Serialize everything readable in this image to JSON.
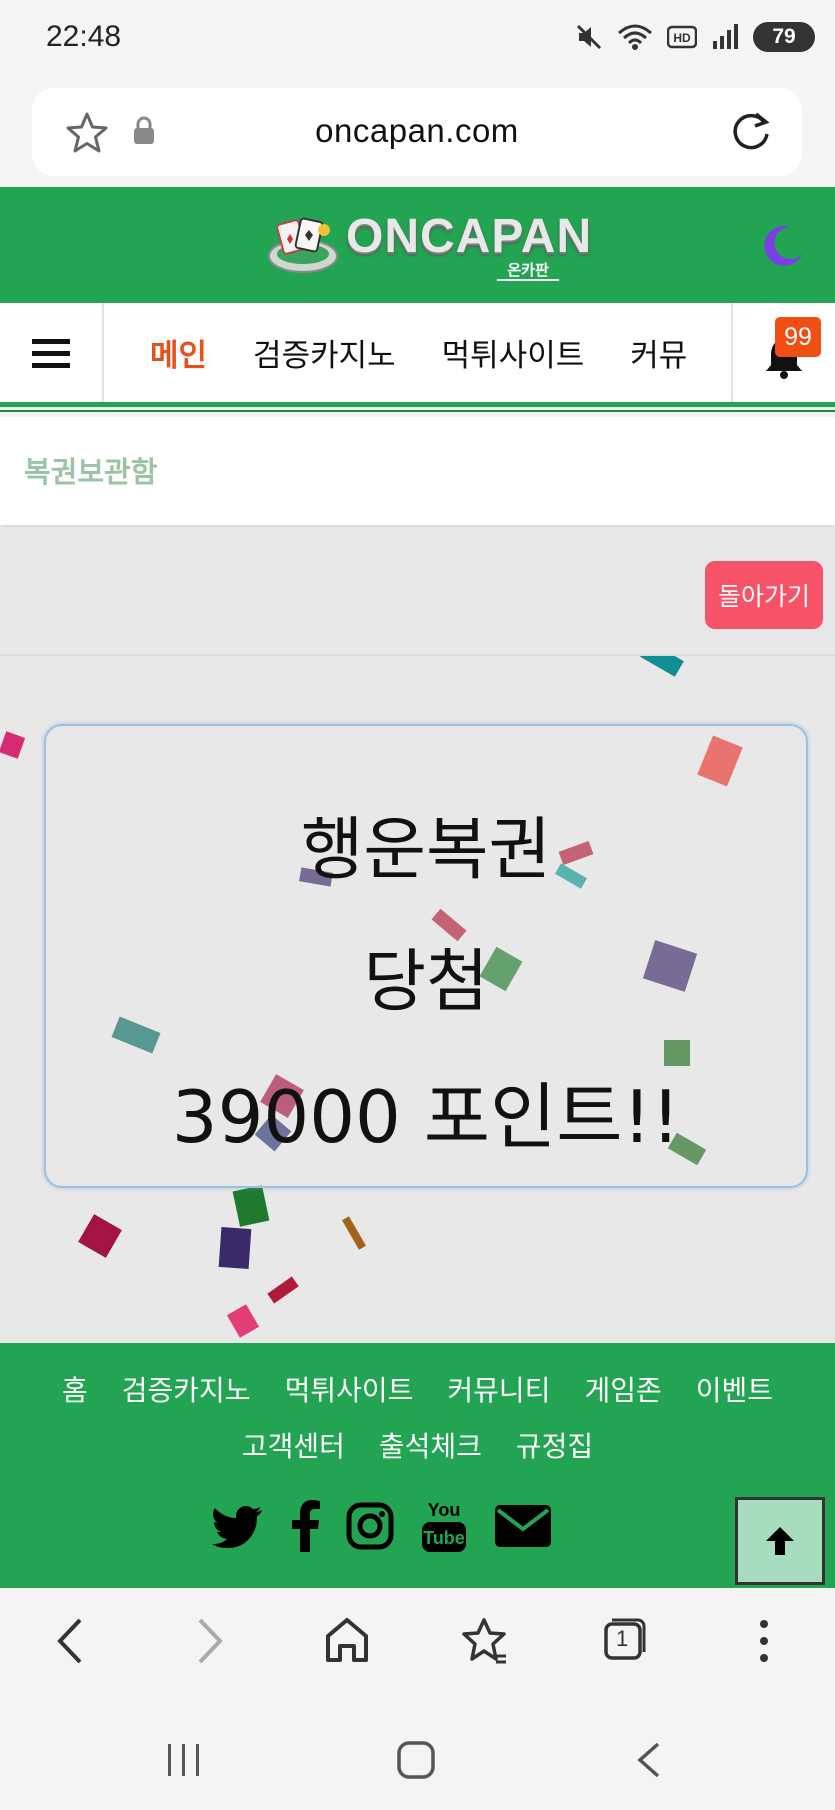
{
  "status_bar": {
    "time": "22:48",
    "battery": "79",
    "icons": [
      "mute-icon",
      "wifi-icon",
      "hd-icon",
      "signal-icon",
      "battery-icon"
    ]
  },
  "address_bar": {
    "url": "oncapan.com"
  },
  "header": {
    "logo_text": "ONCAPAN",
    "logo_sub": "온카판",
    "brand_color": "#22a452"
  },
  "nav": {
    "items": [
      {
        "label": "메인",
        "active": true
      },
      {
        "label": "검증카지노"
      },
      {
        "label": "먹튀사이트"
      },
      {
        "label": "커뮤"
      }
    ],
    "notification_count": "99",
    "active_color": "#e8501b"
  },
  "page": {
    "title": "복권보관함",
    "back_button": "돌아가기"
  },
  "result": {
    "line1": "행운복권",
    "line2": "당첨",
    "line3": "39000 포인트!!"
  },
  "footer": {
    "links_row1": [
      "홈",
      "검증카지노",
      "먹튀사이트",
      "커뮤니티",
      "게임존",
      "이벤트"
    ],
    "links_row2": [
      "고객센터",
      "출석체크",
      "규정집"
    ],
    "social_icons": [
      "twitter-icon",
      "facebook-icon",
      "instagram-icon",
      "youtube-icon",
      "email-icon"
    ]
  },
  "browser_bar": {
    "tab_count": "1"
  }
}
